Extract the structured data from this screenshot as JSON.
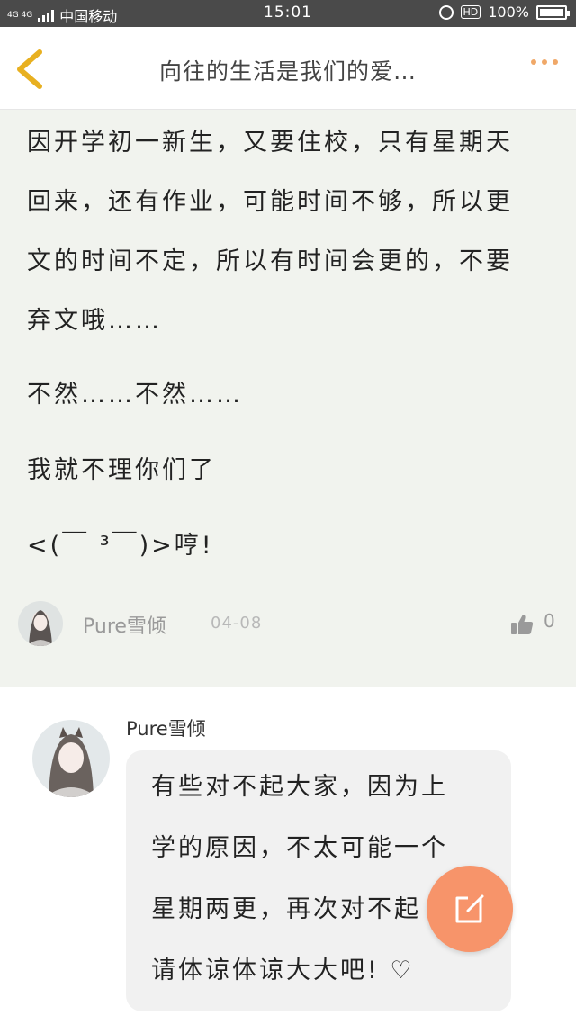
{
  "status_bar": {
    "network": "4G 4G",
    "carrier": "中国移动",
    "time": "15:01",
    "hd": "HD",
    "battery": "100%"
  },
  "nav": {
    "title": "向往的生活是我们的爱…",
    "back_icon": "chevron-left-icon",
    "more_icon": "more-dots-icon"
  },
  "post": {
    "lines": [
      "因开学初一新生，又要住校，只有星期天",
      "回来，还有作业，可能时间不够，所以更",
      "文的时间不定，所以有时间会更的，不要",
      "弃文哦……",
      "不然……不然……",
      "我就不理你们了",
      "<(￣ ³￣)>哼!"
    ],
    "author": {
      "name": "Pure雪倾",
      "date": "04-08",
      "likes": "0",
      "like_icon": "thumbs-up-icon"
    }
  },
  "reply": {
    "author": "Pure雪倾",
    "lines": [
      "有些对不起大家，因为上",
      "学的原因，不太可能一个",
      "星期两更，再次对不起",
      "请体谅体谅大大吧! ♡"
    ]
  },
  "fab": {
    "icon": "edit-icon"
  },
  "colors": {
    "status_bar_bg": "#4a4a4a",
    "post_bg": "#f1f3ee",
    "accent": "#f7946a",
    "back_arrow": "#e8b020"
  }
}
